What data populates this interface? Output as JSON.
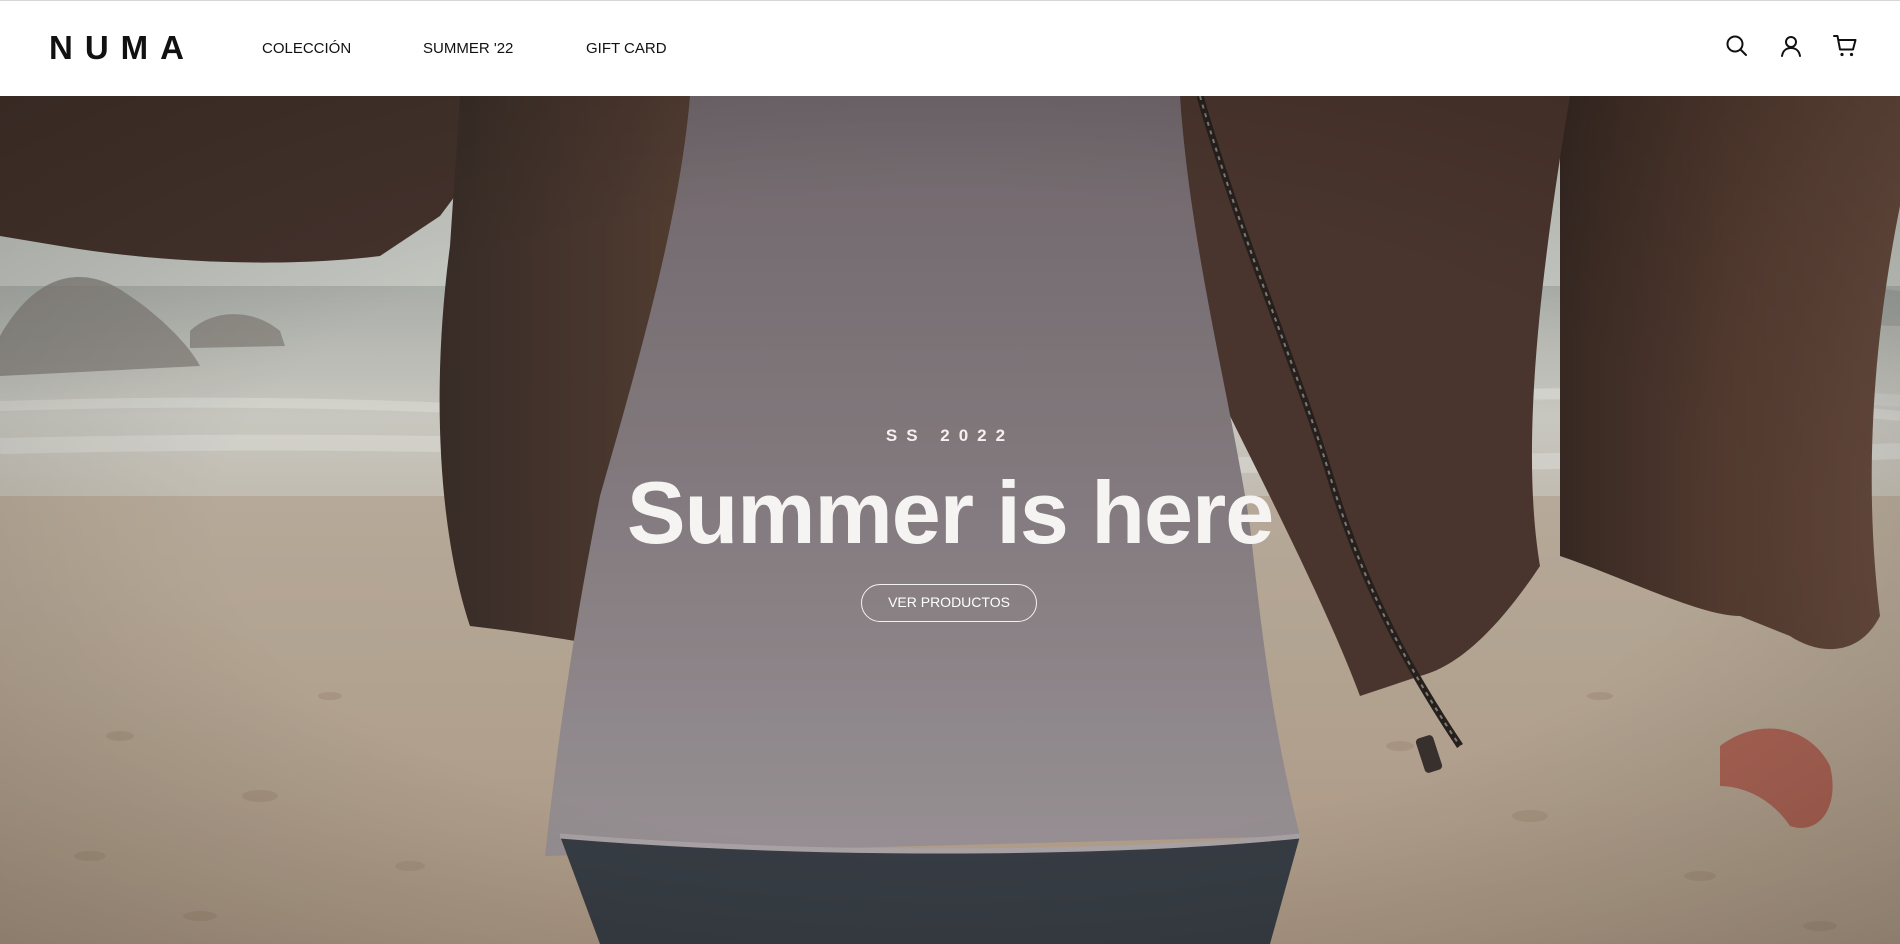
{
  "header": {
    "logo": "NUMA",
    "nav": [
      {
        "label": "COLECCIÓN"
      },
      {
        "label": "SUMMER '22"
      },
      {
        "label": "GIFT CARD"
      }
    ],
    "icons": [
      "search-icon",
      "account-icon",
      "cart-icon"
    ]
  },
  "hero": {
    "kicker": "SS 2022",
    "headline": "Summer is here",
    "cta_label": "VER PRODUCTOS",
    "colors": {
      "text": "#ffffff",
      "sky": "#dfe3df",
      "sand": "#c7b6a2",
      "jacket": "#4d3a31",
      "shirt": "#8d8488",
      "jeans": "#3b4149"
    }
  }
}
